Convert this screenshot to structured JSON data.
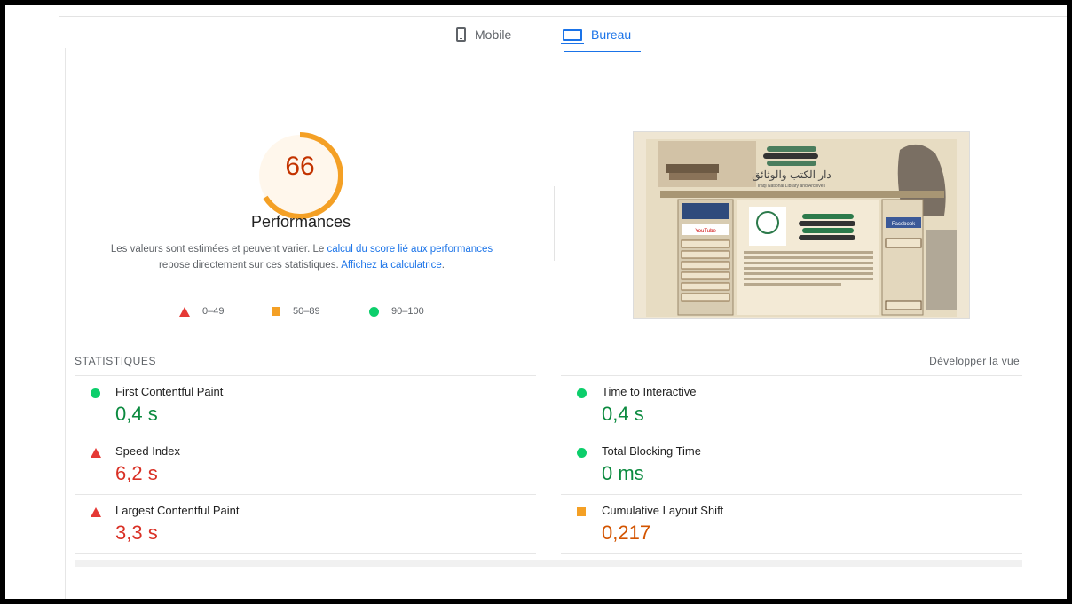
{
  "tabs": {
    "mobile": "Mobile",
    "desktop": "Bureau",
    "active": "desktop",
    "accent_color": "#1a73e8"
  },
  "score": {
    "value": "66",
    "fraction": 0.66,
    "title": "Performances",
    "color": "#f4a025",
    "description_before": "Les valeurs sont estimées et peuvent varier. Le ",
    "link1": "calcul du score lié aux performances",
    "description_mid": " repose directement sur ces statistiques. ",
    "link2": "Affichez la calculatrice",
    "description_end": "."
  },
  "legend": {
    "poor": "0–49",
    "average": "50–89",
    "good": "90–100"
  },
  "screenshot": {
    "title_arabic": "دار الكتب والوثائق",
    "subtitle": "Iraqi National Library and Archives",
    "youtube": "YouTube",
    "facebook": "Facebook"
  },
  "stats": {
    "heading": "STATISTIQUES",
    "expand": "Développer la vue",
    "metrics": [
      {
        "name": "First Contentful Paint",
        "value": "0,4 s",
        "rating": "good"
      },
      {
        "name": "Time to Interactive",
        "value": "0,4 s",
        "rating": "good"
      },
      {
        "name": "Speed Index",
        "value": "6,2 s",
        "rating": "poor"
      },
      {
        "name": "Total Blocking Time",
        "value": "0 ms",
        "rating": "good"
      },
      {
        "name": "Largest Contentful Paint",
        "value": "3,3 s",
        "rating": "poor"
      },
      {
        "name": "Cumulative Layout Shift",
        "value": "0,217",
        "rating": "average"
      }
    ]
  }
}
